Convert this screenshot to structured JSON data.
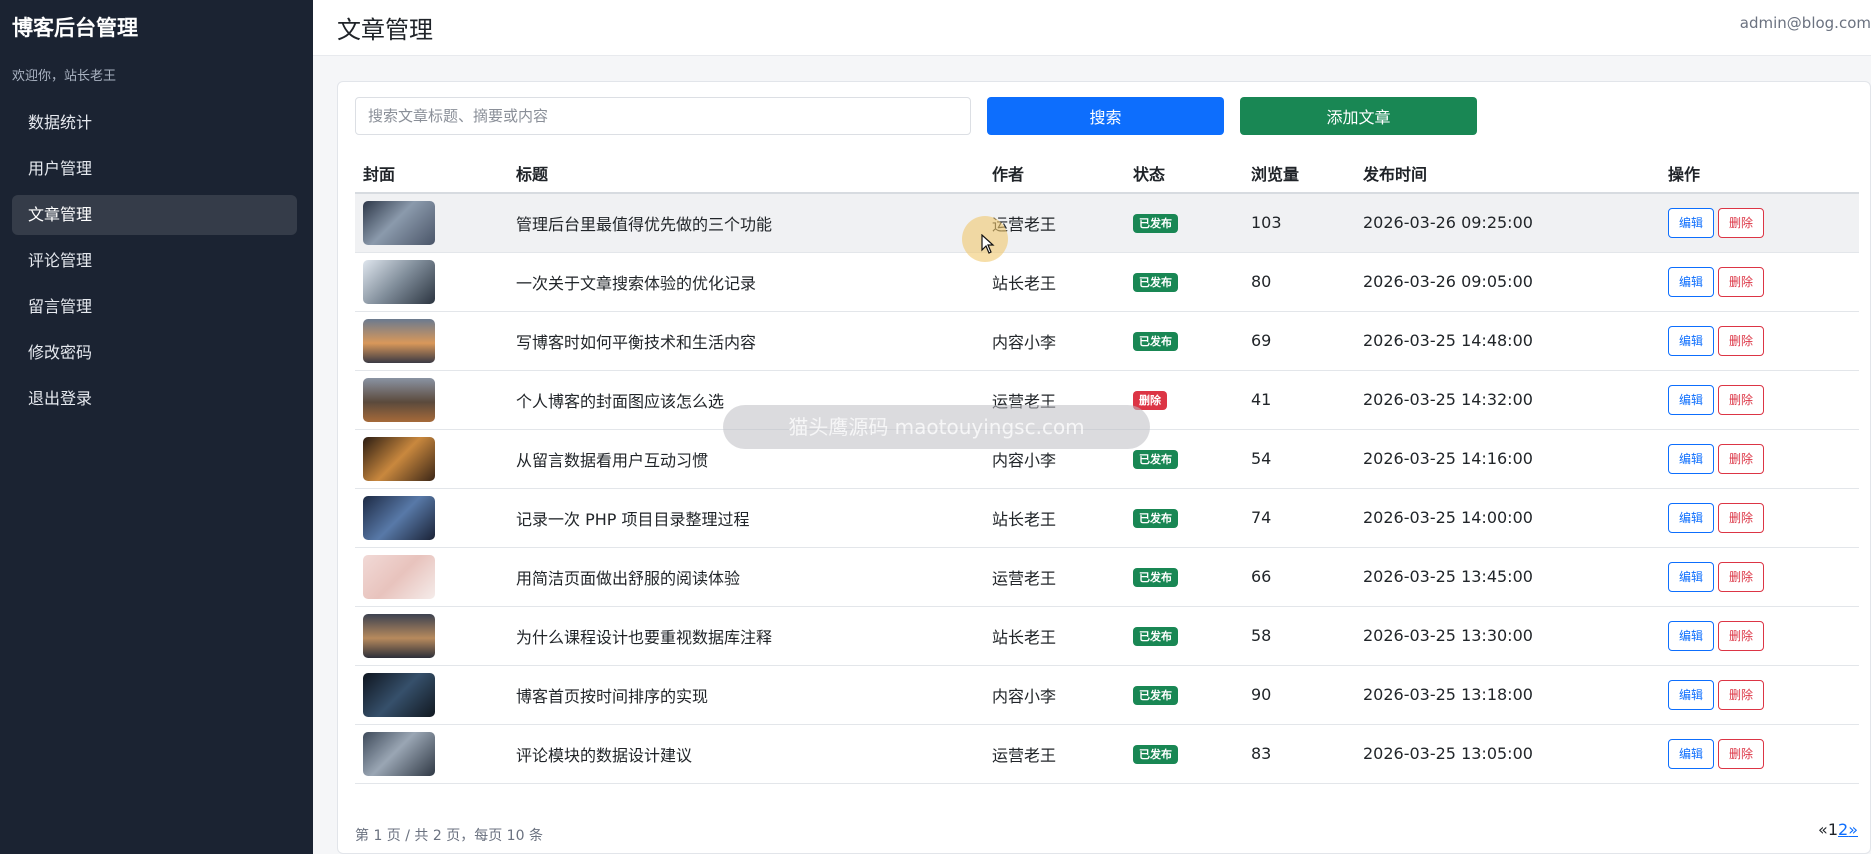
{
  "sidebar": {
    "brand": "博客后台管理",
    "welcome": "欢迎你，站长老王",
    "items": [
      {
        "label": "数据统计",
        "active": false
      },
      {
        "label": "用户管理",
        "active": false
      },
      {
        "label": "文章管理",
        "active": true
      },
      {
        "label": "评论管理",
        "active": false
      },
      {
        "label": "留言管理",
        "active": false
      },
      {
        "label": "修改密码",
        "active": false
      },
      {
        "label": "退出登录",
        "active": false
      }
    ]
  },
  "header": {
    "title": "文章管理",
    "user": "admin@blog.com"
  },
  "toolbar": {
    "search_placeholder": "搜索文章标题、摘要或内容",
    "search_value": "",
    "search_label": "搜索",
    "add_label": "添加文章"
  },
  "table": {
    "columns": [
      "封面",
      "标题",
      "作者",
      "状态",
      "浏览量",
      "发布时间",
      "操作"
    ],
    "rows": [
      {
        "title": "管理后台里最值得优先做的三个功能",
        "author": "运营老王",
        "status": "已发布",
        "views": "103",
        "time": "2026-03-26 09:25:00"
      },
      {
        "title": "一次关于文章搜索体验的优化记录",
        "author": "站长老王",
        "status": "已发布",
        "views": "80",
        "time": "2026-03-26 09:05:00"
      },
      {
        "title": "写博客时如何平衡技术和生活内容",
        "author": "内容小李",
        "status": "已发布",
        "views": "69",
        "time": "2026-03-25 14:48:00"
      },
      {
        "title": "个人博客的封面图应该怎么选",
        "author": "运营老王",
        "status": "删除",
        "views": "41",
        "time": "2026-03-25 14:32:00"
      },
      {
        "title": "从留言数据看用户互动习惯",
        "author": "内容小李",
        "status": "已发布",
        "views": "54",
        "time": "2026-03-25 14:16:00"
      },
      {
        "title": "记录一次 PHP 项目目录整理过程",
        "author": "站长老王",
        "status": "已发布",
        "views": "74",
        "time": "2026-03-25 14:00:00"
      },
      {
        "title": "用简洁页面做出舒服的阅读体验",
        "author": "运营老王",
        "status": "已发布",
        "views": "66",
        "time": "2026-03-25 13:45:00"
      },
      {
        "title": "为什么课程设计也要重视数据库注释",
        "author": "站长老王",
        "status": "已发布",
        "views": "58",
        "time": "2026-03-25 13:30:00"
      },
      {
        "title": "博客首页按时间排序的实现",
        "author": "内容小李",
        "status": "已发布",
        "views": "90",
        "time": "2026-03-25 13:18:00"
      },
      {
        "title": "评论模块的数据设计建议",
        "author": "运营老王",
        "status": "已发布",
        "views": "83",
        "time": "2026-03-25 13:05:00"
      }
    ],
    "edit_label": "编辑",
    "delete_label": "删除"
  },
  "footer": {
    "info": "第 1 页 / 共 2 页，每页 10 条",
    "prev": "«",
    "page1": "1",
    "page2": "2",
    "next": "»"
  },
  "watermark": "猫头鹰源码 maotouyingsc.com",
  "colors": {
    "sidebar_bg": "#1b2332",
    "primary": "#0d6efd",
    "success": "#198754",
    "danger": "#dc3545"
  }
}
